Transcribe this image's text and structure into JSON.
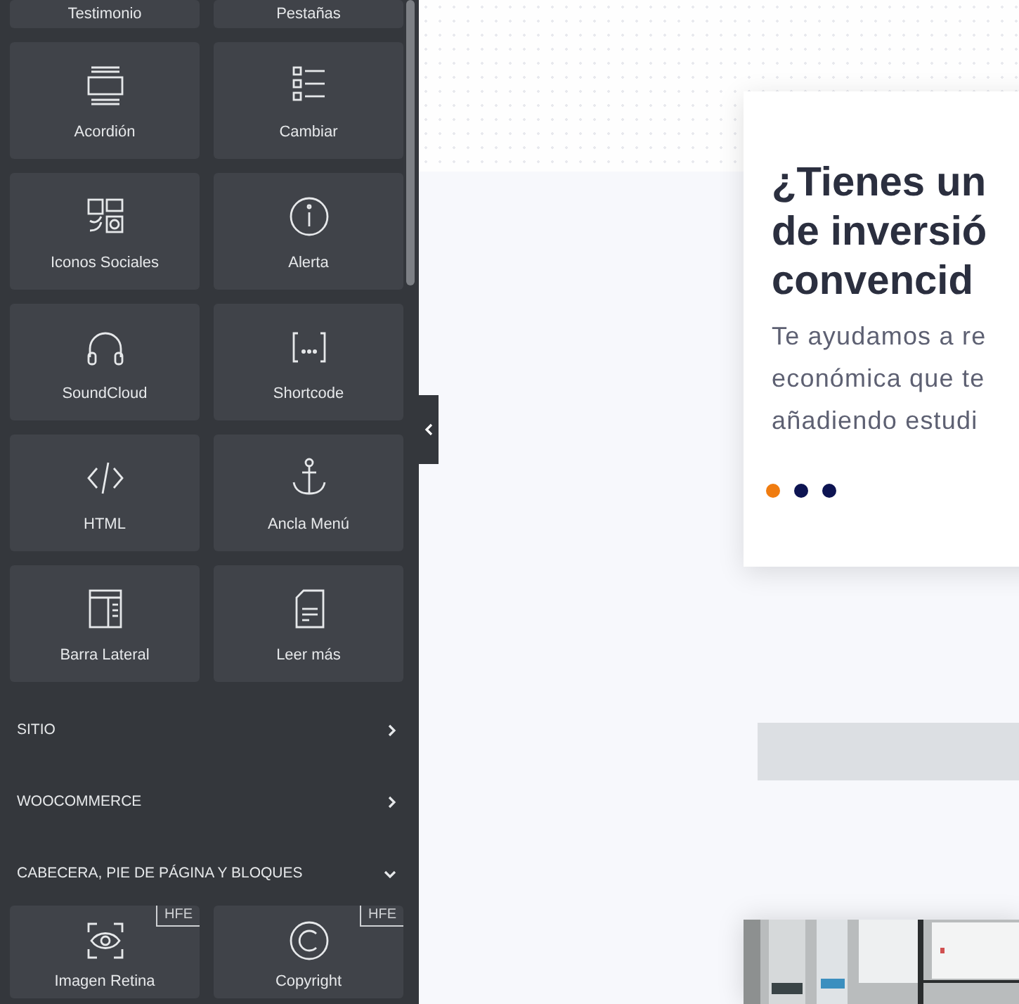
{
  "widgets_top": [
    {
      "label": "Testimonio"
    },
    {
      "label": "Pestañas"
    },
    {
      "label": "Acordión"
    },
    {
      "label": "Cambiar"
    },
    {
      "label": "Iconos Sociales"
    },
    {
      "label": "Alerta"
    },
    {
      "label": "SoundCloud"
    },
    {
      "label": "Shortcode"
    },
    {
      "label": "HTML"
    },
    {
      "label": "Ancla Menú"
    },
    {
      "label": "Barra Lateral"
    },
    {
      "label": "Leer más"
    }
  ],
  "categories": [
    {
      "label": "SITIO",
      "expanded": false
    },
    {
      "label": "WOOCOMMERCE",
      "expanded": false
    },
    {
      "label": "CABECERA, PIE DE PÁGINA Y BLOQUES",
      "expanded": true
    }
  ],
  "widgets_bottom": [
    {
      "label": "Imagen Retina",
      "badge": "HFE"
    },
    {
      "label": "Copyright",
      "badge": "HFE"
    }
  ],
  "slide": {
    "heading_lines": [
      "¿Tienes un",
      "de inversió",
      "convencid"
    ],
    "text_lines": [
      "Te ayudamos a re",
      "económica que te",
      "añadiendo estudi"
    ],
    "dots": [
      {
        "selected": true
      },
      {
        "selected": false
      },
      {
        "selected": false
      }
    ]
  }
}
